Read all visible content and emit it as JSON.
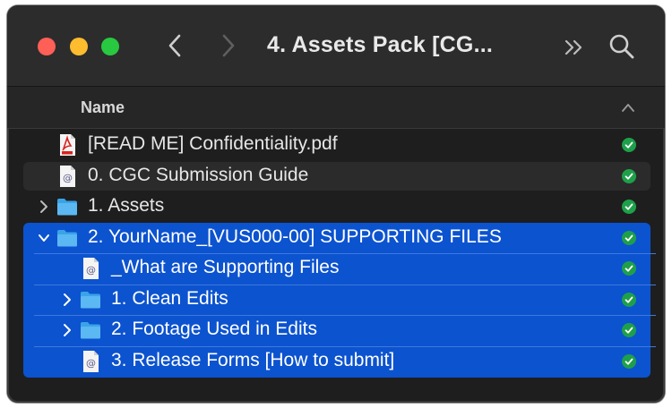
{
  "window": {
    "title": "4. Assets Pack [CG...",
    "column_header": "Name"
  },
  "colors": {
    "selection": "#0c53cf",
    "folder": "#3aa3e8",
    "synced": "#1ea04a"
  },
  "files": [
    {
      "label": "[READ ME] Confidentiality.pdf",
      "icon": "pdf-file-icon",
      "expandable": false,
      "expanded": false,
      "indent": 0,
      "selected": false,
      "status": "synced-checkmark"
    },
    {
      "label": "0. CGC Submission Guide",
      "icon": "webloc-file-icon",
      "expandable": false,
      "expanded": false,
      "indent": 0,
      "selected": false,
      "status": "synced-checkmark"
    },
    {
      "label": "1. Assets",
      "icon": "folder-icon",
      "expandable": true,
      "expanded": false,
      "indent": 0,
      "selected": false,
      "status": "synced-checkmark"
    },
    {
      "label": "2. YourName_[VUS000-00] SUPPORTING FILES",
      "icon": "folder-icon",
      "expandable": true,
      "expanded": true,
      "indent": 0,
      "selected": true,
      "status": "synced-checkmark"
    },
    {
      "label": "_What are Supporting Files",
      "icon": "webloc-file-icon",
      "expandable": false,
      "expanded": false,
      "indent": 1,
      "selected": true,
      "status": "synced-checkmark"
    },
    {
      "label": "1. Clean Edits",
      "icon": "folder-icon",
      "expandable": true,
      "expanded": false,
      "indent": 1,
      "selected": true,
      "status": "synced-checkmark"
    },
    {
      "label": "2. Footage Used in Edits",
      "icon": "folder-icon",
      "expandable": true,
      "expanded": false,
      "indent": 1,
      "selected": true,
      "status": "synced-checkmark"
    },
    {
      "label": "3. Release Forms [How to submit]",
      "icon": "webloc-file-icon",
      "expandable": false,
      "expanded": false,
      "indent": 1,
      "selected": true,
      "status": "synced-checkmark"
    }
  ]
}
